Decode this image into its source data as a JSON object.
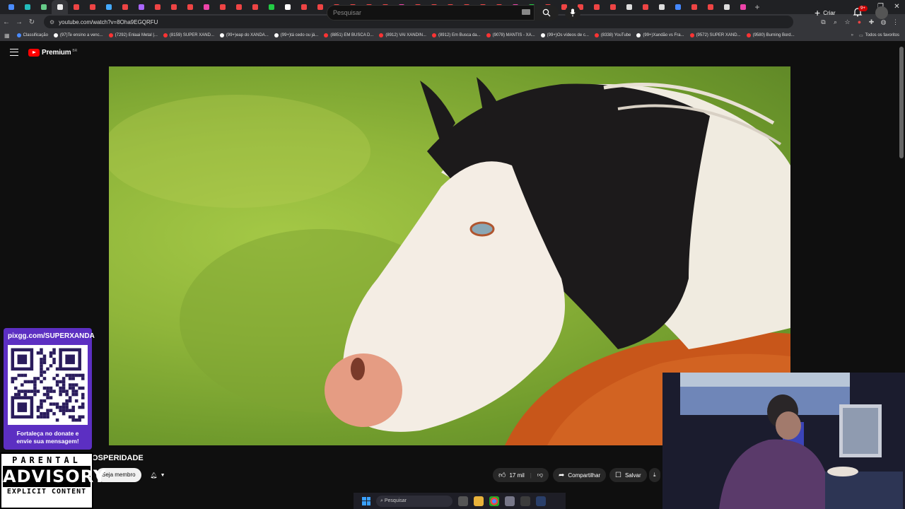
{
  "browser": {
    "url": "youtube.com/watch?v=8Oha9EGQRFU",
    "bookmarks": [
      {
        "label": "Classificação",
        "color": "#4a8cff"
      },
      {
        "label": "(97)Te ensino a venc...",
        "color": "#ffffff"
      },
      {
        "label": "(7292) Enlaai Metal |...",
        "color": "#ff3333"
      },
      {
        "label": "(8159) SUPER XAND...",
        "color": "#ff3333"
      },
      {
        "label": "(99+)eap do XANDA...",
        "color": "#ffffff"
      },
      {
        "label": "(99+)tá cedo ou já...",
        "color": "#ffffff"
      },
      {
        "label": "(8851) EM BUSCA D...",
        "color": "#ff3333"
      },
      {
        "label": "(8912) VAI XANDIN...",
        "color": "#ff3333"
      },
      {
        "label": "(8912) Em Busca da...",
        "color": "#ff3333"
      },
      {
        "label": "(9078) MANTIS - XA...",
        "color": "#ff3333"
      },
      {
        "label": "(99+)Os vídeos de c...",
        "color": "#ffffff"
      },
      {
        "label": "(8338) YouTube",
        "color": "#ff3333"
      },
      {
        "label": "(99+)Xandão vs Fra...",
        "color": "#ffffff"
      },
      {
        "label": "(9572) SUPER XAND...",
        "color": "#ff3333"
      },
      {
        "label": "(9580) Burning Bord...",
        "color": "#ff3333"
      }
    ],
    "all_bookmarks": "Todos os favoritos"
  },
  "youtube": {
    "logo": "Premium",
    "region": "BR",
    "search_placeholder": "Pesquisar",
    "create_label": "Criar",
    "notifications": "9+"
  },
  "video": {
    "title_fragment": "OSPERIDADE",
    "member_button": "Seja membro",
    "likes": "17 mil",
    "share": "Compartilhar",
    "save": "Salvar"
  },
  "overlay": {
    "qr_url": "pixgg.com/SUPERXANDA",
    "qr_message_1": "Fortaleça no donate e",
    "qr_message_2": "envie sua mensagem!",
    "advisory_1": "PARENTAL",
    "advisory_2": "ADVISORY",
    "advisory_3": "EXPLICIT CONTENT"
  },
  "taskbar": {
    "search": "Pesquisar"
  }
}
